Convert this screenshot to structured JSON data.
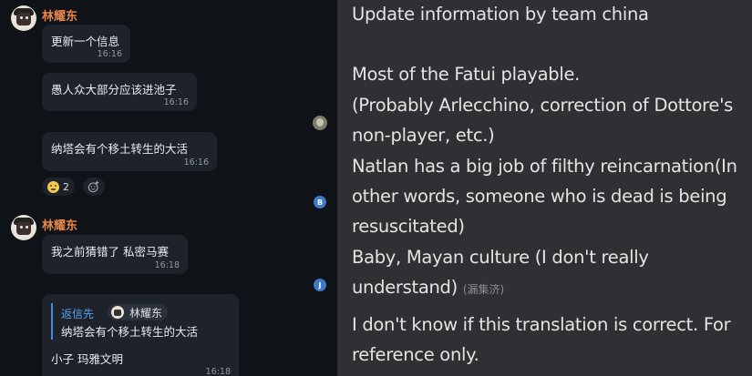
{
  "chat": {
    "group1": {
      "sender": "林耀东",
      "messages": [
        {
          "text": "更新一个信息",
          "time": "16:16"
        },
        {
          "text": "愚人众大部分应该进池子",
          "time": "16:16"
        },
        {
          "text": "纳塔会有个移土转生的大活",
          "time": "16:16"
        }
      ],
      "reaction": {
        "emoji": "sweat-smile-emoji",
        "count": "2"
      }
    },
    "read_markers": [
      {
        "type": "avatar"
      },
      {
        "letter": "B",
        "color": "#3d78c9"
      },
      {
        "letter": "J",
        "color": "#3d78c9"
      }
    ],
    "group2": {
      "sender": "林耀东",
      "messages": [
        {
          "text": "我之前猜错了 私密马赛",
          "time": "16:18"
        }
      ],
      "reply": {
        "author": "返信先",
        "quoted_sender": "林耀东",
        "quoted_text": "纳塔会有个移土转生的大活",
        "text": "小子 玛雅文明",
        "time": "16:18"
      }
    }
  },
  "translation": {
    "lines": [
      "Update information by team china",
      "Most of the Fatui playable.",
      "(Probably Arlecchino, correction of Dottore's",
      "non-player, etc.)",
      "Natlan has a big job of filthy reincarnation(In",
      "other words, someone who is dead is being",
      "resuscitated)",
      "Baby, Mayan culture (I don't really",
      "understand)",
      "I don't know if this translation is correct. For",
      "reference only."
    ],
    "credit": "(漏集济)"
  }
}
